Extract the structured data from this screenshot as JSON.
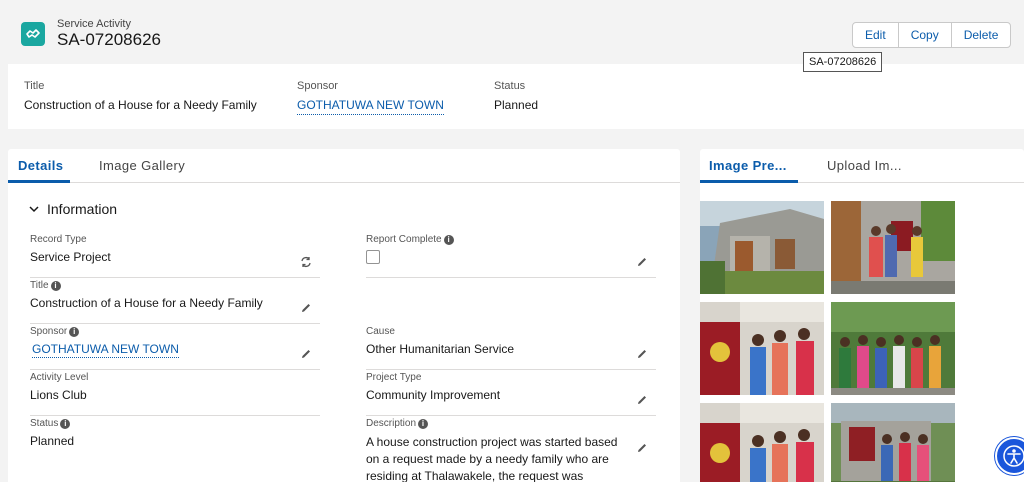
{
  "header": {
    "object_type": "Service Activity",
    "record_name": "SA-07208626",
    "icon": "handshake-icon",
    "icon_color": "#1aa7a0",
    "buttons": {
      "edit": "Edit",
      "copy": "Copy",
      "delete": "Delete"
    },
    "tooltip": "SA-07208626"
  },
  "highlights": {
    "title_label": "Title",
    "title_value": "Construction of a House for a Needy Family",
    "sponsor_label": "Sponsor",
    "sponsor_value": "GOTHATUWA NEW TOWN",
    "status_label": "Status",
    "status_value": "Planned"
  },
  "main": {
    "tabs": {
      "details": "Details",
      "gallery": "Image Gallery"
    },
    "section_title": "Information",
    "fields": {
      "record_type_label": "Record Type",
      "record_type_value": "Service Project",
      "report_complete_label": "Report Complete",
      "title_label": "Title",
      "title_value": "Construction of a House for a Needy Family",
      "sponsor_label": "Sponsor",
      "sponsor_value": "GOTHATUWA NEW TOWN",
      "cause_label": "Cause",
      "cause_value": "Other Humanitarian Service",
      "activity_level_label": "Activity Level",
      "activity_level_value": "Lions Club",
      "project_type_label": "Project Type",
      "project_type_value": "Community Improvement",
      "status_label": "Status",
      "status_value": "Planned",
      "description_label": "Description",
      "description_value": "A house construction project was started based on a request made by a needy family who are residing at Thalawakele, the request was presented to the Board"
    }
  },
  "side": {
    "tabs": {
      "preview": "Image Pre...",
      "upload": "Upload Im..."
    }
  },
  "colors": {
    "accent": "#0b5cab",
    "background": "#f3f3f3"
  }
}
